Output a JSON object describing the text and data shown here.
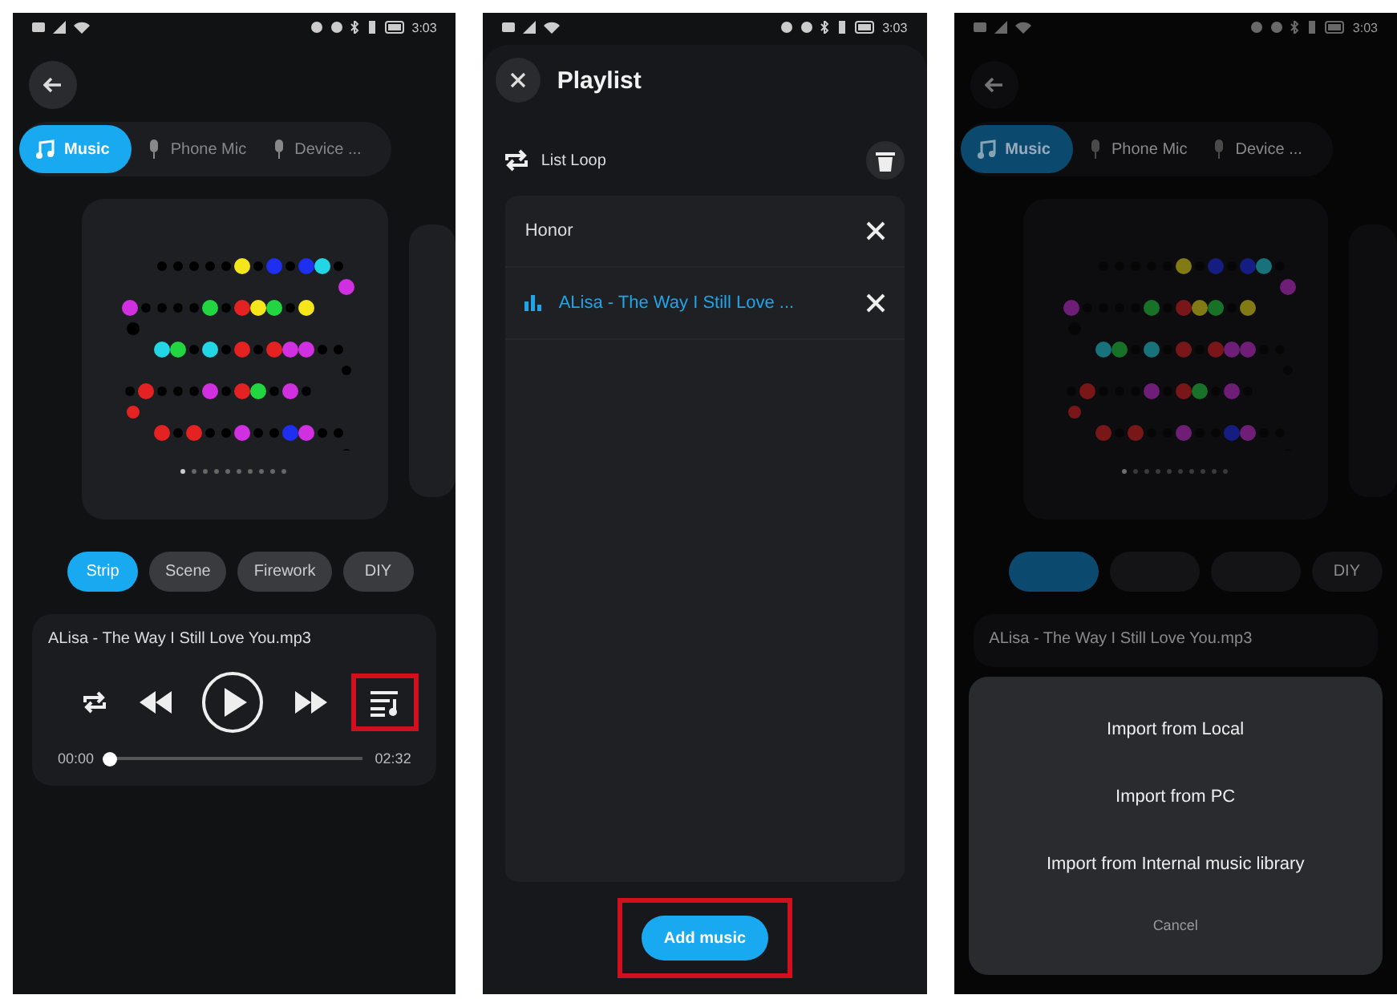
{
  "screens": [
    {
      "kind": "player",
      "dimmed": false,
      "status_bar": {
        "time": "3:03"
      },
      "source_tabs": [
        {
          "label": "Music",
          "selected": true
        },
        {
          "label": "Phone Mic",
          "selected": false
        },
        {
          "label": "Device ...",
          "selected": false
        }
      ],
      "effect_chips": [
        {
          "label": "Strip",
          "selected": true
        },
        {
          "label": "Scene",
          "selected": false
        },
        {
          "label": "Firework",
          "selected": false
        },
        {
          "label": "DIY",
          "selected": false
        }
      ],
      "player": {
        "track": "ALisa - The Way I Still Love You.mp3",
        "elapsed": "00:00",
        "duration": "02:32",
        "level": 0.01,
        "playing": false,
        "playlist_highlighted": true
      }
    },
    {
      "kind": "playlist",
      "status_bar": {
        "time": "3:03"
      },
      "title": "Playlist",
      "mode": "List Loop",
      "items": [
        {
          "name": "Honor",
          "playing": false
        },
        {
          "name": "ALisa - The Way I Still Love ...",
          "playing": true
        }
      ],
      "add_button": {
        "label": "Add music",
        "highlighted": true
      }
    },
    {
      "kind": "player",
      "dimmed": true,
      "status_bar": {
        "time": "3:03"
      },
      "source_tabs": [
        {
          "label": "Music",
          "selected": true
        },
        {
          "label": "Phone Mic",
          "selected": false
        },
        {
          "label": "Device ...",
          "selected": false
        }
      ],
      "effect_chips": [
        {
          "selected": true
        },
        {
          "selected": false
        },
        {
          "selected": false
        },
        {
          "label": "DIY",
          "selected": false
        }
      ],
      "player": {
        "track": "ALisa - The Way I Still Love You.mp3"
      },
      "action_sheet": {
        "options": [
          "Import from Local",
          "Import from PC",
          "Import from Internal music library"
        ],
        "cancel": "Cancel"
      }
    }
  ]
}
